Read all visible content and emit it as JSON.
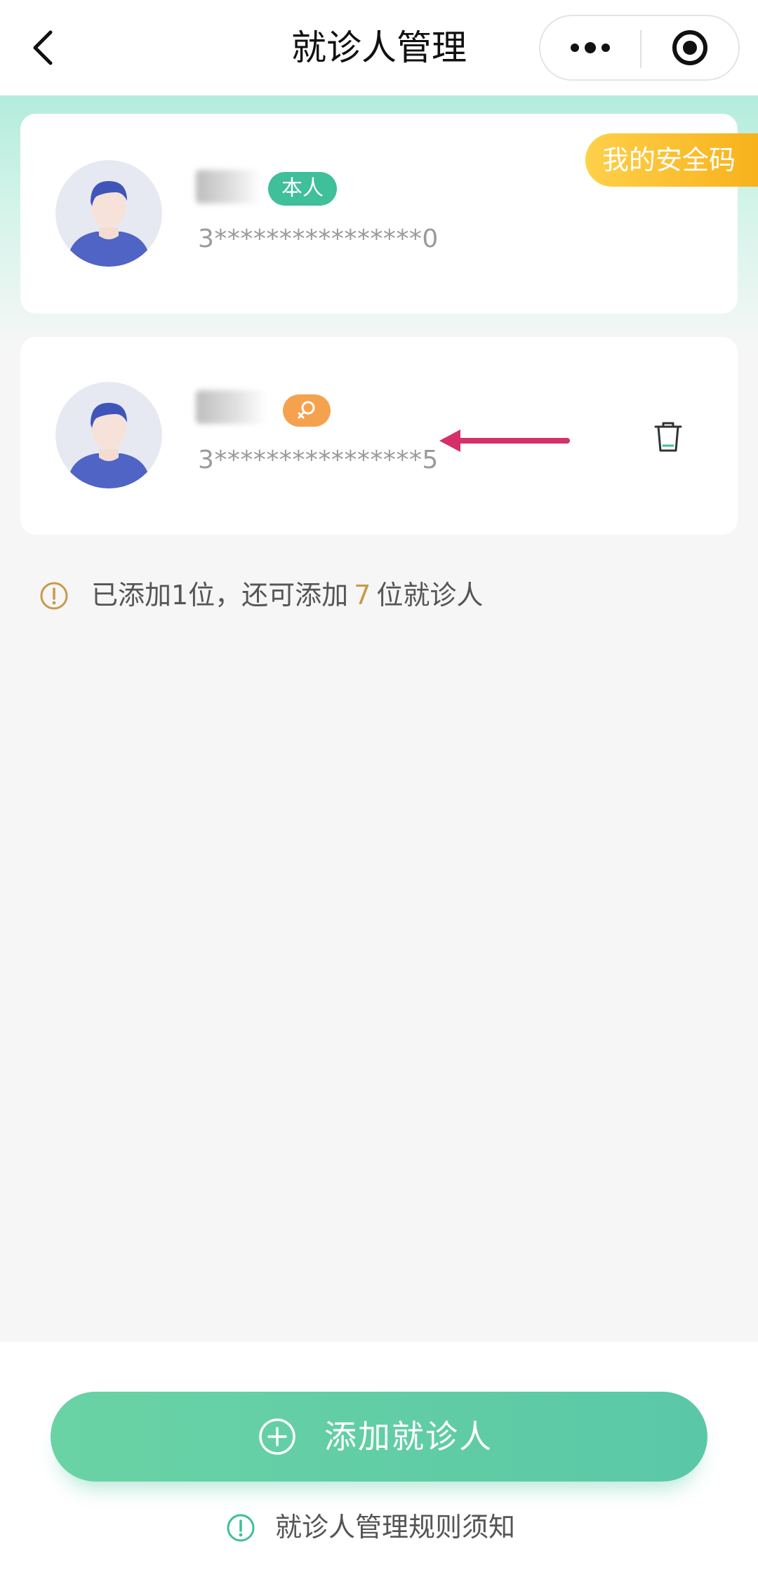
{
  "nav": {
    "title": "就诊人管理",
    "back_icon": "chevron-left-icon",
    "more_icon": "more-dots-icon",
    "close_icon": "target-circle-icon"
  },
  "patients": [
    {
      "tag": "本人",
      "tag_color": "#3fbf9a",
      "id_masked": "3****************0",
      "badge": "我的安全码",
      "badge_color": "#f7b21c"
    },
    {
      "gender_icon": "female-symbol-icon",
      "tag_color": "#f5a24e",
      "id_masked": "3****************5",
      "delete_icon": "trash-icon"
    }
  ],
  "annotation": {
    "arrow_color": "#d62f6a"
  },
  "notice": {
    "prefix": "已添加1位，还可添加",
    "count": "7",
    "suffix": "位就诊人",
    "icon": "info-circle-icon",
    "icon_color": "#c99a4a"
  },
  "footer": {
    "add_button_label": "添加就诊人",
    "add_icon": "plus-circle-icon",
    "rules_label": "就诊人管理规则须知",
    "rules_icon": "info-circle-icon",
    "accent_color": "#5ac8a7"
  }
}
